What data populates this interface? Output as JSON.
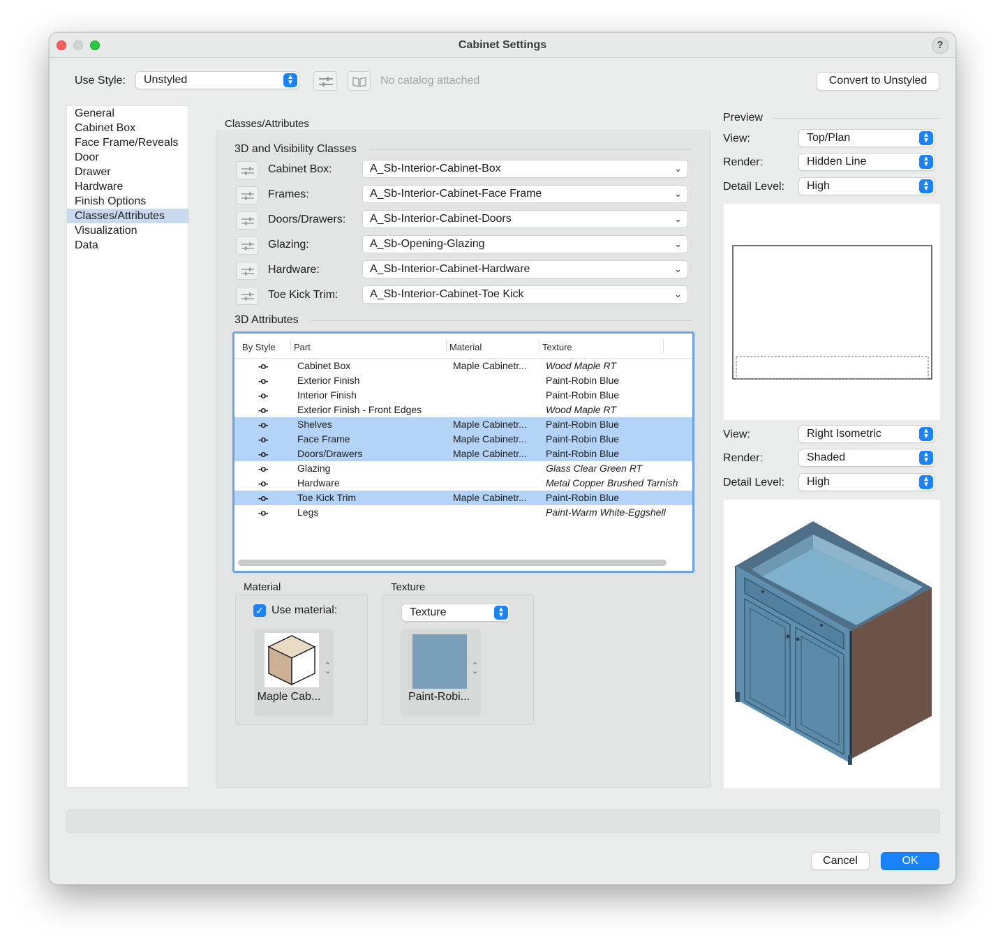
{
  "window": {
    "title": "Cabinet Settings",
    "help": "?"
  },
  "header": {
    "use_style_label": "Use Style:",
    "use_style_value": "Unstyled",
    "catalog_text": "No catalog attached",
    "convert_button": "Convert to Unstyled"
  },
  "sidebar": {
    "items": [
      {
        "label": "General"
      },
      {
        "label": "Cabinet Box"
      },
      {
        "label": "Face Frame/Reveals"
      },
      {
        "label": "Door"
      },
      {
        "label": "Drawer"
      },
      {
        "label": "Hardware"
      },
      {
        "label": "Finish Options"
      },
      {
        "label": "Classes/Attributes"
      },
      {
        "label": "Visualization"
      },
      {
        "label": "Data"
      }
    ],
    "selected": "Classes/Attributes"
  },
  "main": {
    "panel_title": "Classes/Attributes",
    "visibility_section": "3D and Visibility Classes",
    "classes": [
      {
        "label": "Cabinet Box:",
        "value": "A_Sb-Interior-Cabinet-Box"
      },
      {
        "label": "Frames:",
        "value": "A_Sb-Interior-Cabinet-Face Frame"
      },
      {
        "label": "Doors/Drawers:",
        "value": "A_Sb-Interior-Cabinet-Doors"
      },
      {
        "label": "Glazing:",
        "value": "A_Sb-Opening-Glazing"
      },
      {
        "label": "Hardware:",
        "value": "A_Sb-Interior-Cabinet-Hardware"
      },
      {
        "label": "Toe Kick Trim:",
        "value": "A_Sb-Interior-Cabinet-Toe Kick"
      }
    ],
    "attributes_section": "3D Attributes",
    "table": {
      "columns": [
        "By Style",
        "Part",
        "Material",
        "Texture"
      ],
      "rows": [
        {
          "bystyle": "-o-",
          "part": "Cabinet Box",
          "material": "Maple Cabinetr...",
          "texture": "Wood Maple RT",
          "texture_italic": true,
          "selected": false
        },
        {
          "bystyle": "-o-",
          "part": "Exterior Finish",
          "material": "",
          "texture": "Paint-Robin Blue",
          "texture_italic": false,
          "selected": false
        },
        {
          "bystyle": "-o-",
          "part": "Interior Finish",
          "material": "",
          "texture": "Paint-Robin Blue",
          "texture_italic": false,
          "selected": false
        },
        {
          "bystyle": "-o-",
          "part": "Exterior Finish - Front Edges",
          "material": "",
          "texture": "Wood Maple RT",
          "texture_italic": true,
          "selected": false
        },
        {
          "bystyle": "-o-",
          "part": "Shelves",
          "material": "Maple Cabinetr...",
          "texture": "Paint-Robin Blue",
          "texture_italic": false,
          "selected": true
        },
        {
          "bystyle": "-o-",
          "part": "Face Frame",
          "material": "Maple Cabinetr...",
          "texture": "Paint-Robin Blue",
          "texture_italic": false,
          "selected": true
        },
        {
          "bystyle": "-o-",
          "part": "Doors/Drawers",
          "material": "Maple Cabinetr...",
          "texture": "Paint-Robin Blue",
          "texture_italic": false,
          "selected": true
        },
        {
          "bystyle": "-o-",
          "part": "Glazing",
          "material": "",
          "texture": "Glass Clear Green RT",
          "texture_italic": true,
          "selected": false
        },
        {
          "bystyle": "-o-",
          "part": "Hardware",
          "material": "",
          "texture": "Metal Copper Brushed Tarnish",
          "texture_italic": true,
          "selected": false
        },
        {
          "bystyle": "-o-",
          "part": "Toe Kick Trim",
          "material": "Maple Cabinetr...",
          "texture": "Paint-Robin Blue",
          "texture_italic": false,
          "selected": true
        },
        {
          "bystyle": "-o-",
          "part": "Legs",
          "material": "",
          "texture": "Paint-Warm White-Eggshell",
          "texture_italic": true,
          "selected": false
        }
      ]
    },
    "material": {
      "group_label": "Material",
      "use_material_label": "Use material:",
      "use_material_checked": true,
      "swatch_name": "Maple Cab..."
    },
    "texture": {
      "group_label": "Texture",
      "type_value": "Texture",
      "swatch_name": "Paint-Robi...",
      "swatch_color": "#7a9fb8"
    }
  },
  "preview": {
    "title": "Preview",
    "top": {
      "view_label": "View:",
      "view_value": "Top/Plan",
      "render_label": "Render:",
      "render_value": "Hidden Line",
      "detail_label": "Detail Level:",
      "detail_value": "High"
    },
    "bottom": {
      "view_label": "View:",
      "view_value": "Right Isometric",
      "render_label": "Render:",
      "render_value": "Shaded",
      "detail_label": "Detail Level:",
      "detail_value": "High"
    }
  },
  "footer": {
    "cancel": "Cancel",
    "ok": "OK"
  },
  "colors": {
    "accent": "#1a82fb",
    "selection": "#b3d4f6",
    "cabinet_blue": "#5f8fae",
    "cabinet_wood": "#6b5447"
  }
}
